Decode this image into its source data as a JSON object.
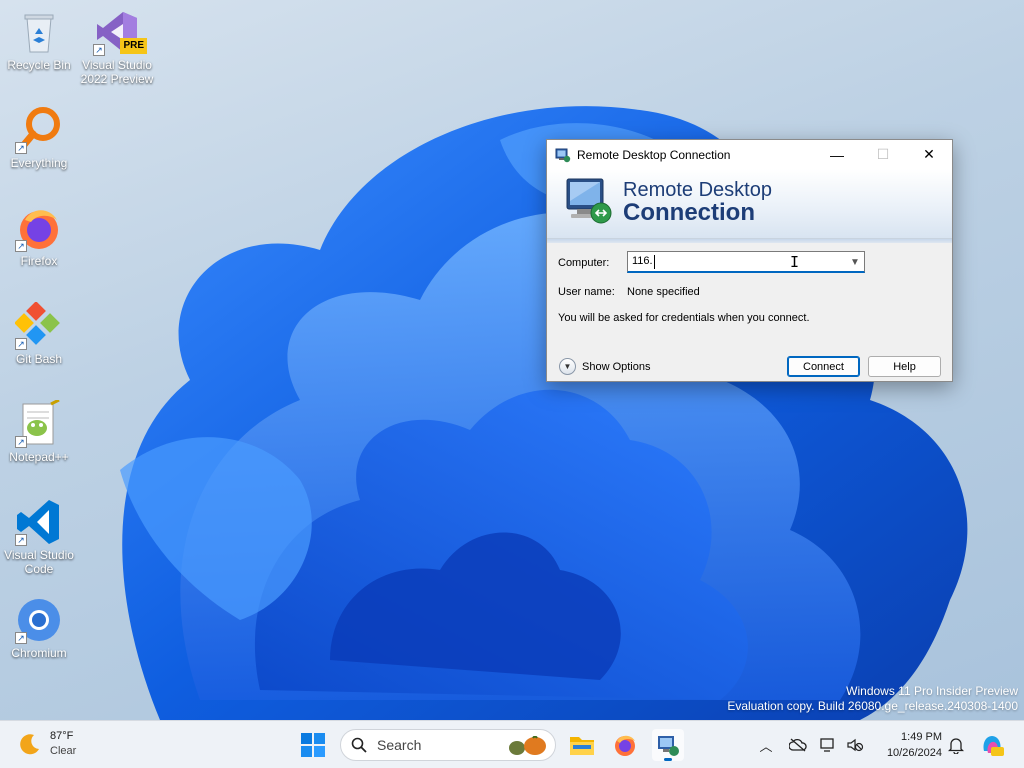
{
  "desktop": {
    "icons": [
      {
        "label": "Recycle Bin"
      },
      {
        "label": "Visual Studio 2022 Preview",
        "badge": "PRE"
      },
      {
        "label": "Everything"
      },
      {
        "label": "Firefox"
      },
      {
        "label": "Git Bash"
      },
      {
        "label": "Notepad++"
      },
      {
        "label": "Visual Studio Code"
      },
      {
        "label": "Chromium"
      }
    ],
    "watermark": {
      "line1": "Windows 11 Pro Insider Preview",
      "line2": "Evaluation copy. Build 26080.ge_release.240308-1400"
    }
  },
  "rdp_window": {
    "title": "Remote Desktop Connection",
    "banner_line1": "Remote Desktop",
    "banner_line2": "Connection",
    "computer_label": "Computer:",
    "computer_value": "116.",
    "username_label": "User name:",
    "username_value": "None specified",
    "info_text": "You will be asked for credentials when you connect.",
    "show_options": "Show Options",
    "connect_button": "Connect",
    "help_button": "Help"
  },
  "taskbar": {
    "weather_temp": "87°F",
    "weather_condition": "Clear",
    "search_placeholder": "Search",
    "clock_time": "1:49 PM",
    "clock_date": "10/26/2024"
  },
  "colors": {
    "accent": "#0067c0",
    "banner_text": "#1d3d77",
    "wallpaper_blue": "#1565e0"
  }
}
